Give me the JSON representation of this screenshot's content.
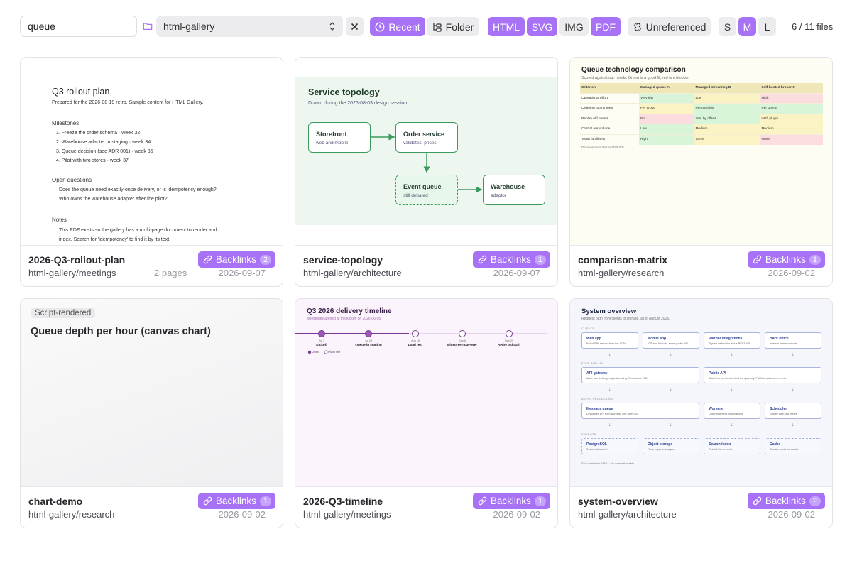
{
  "toolbar": {
    "search_value": "queue",
    "folder_select": "html-gallery",
    "buttons": {
      "recent": "Recent",
      "folder": "Folder",
      "html": "HTML",
      "svg": "SVG",
      "img": "IMG",
      "pdf": "PDF",
      "unreferenced": "Unreferenced",
      "size_s": "S",
      "size_m": "M",
      "size_l": "L"
    },
    "file_count": "6 / 11 files",
    "colors": {
      "accent": "#a772f5",
      "neutral": "#ececef"
    }
  },
  "cards": [
    {
      "name": "2026-Q3-rollout-plan",
      "path": "html-gallery/meetings",
      "pages": "2 pages",
      "date": "2026-09-07",
      "backlinks_label": "Backlinks",
      "backlinks_count": "2",
      "preview": {
        "title": "Q3 rollout plan",
        "subtitle": "Prepared for the 2026-08-19 retro. Sample content for HTML Gallery.",
        "milestones_heading": "Milestones",
        "milestones": [
          "1.  Freeze the order schema  ·  week 32",
          "2.  Warehouse adapter in staging  ·  week 34",
          "3.  Queue decision (see ADR 001)  ·  week 35",
          "4.  Pilot with two stores  ·  week 37"
        ],
        "questions_heading": "Open questions",
        "questions": [
          "Does the queue need exactly-once delivery, or is idempotency enough?",
          "Who owns the warehouse adapter after the pilot?"
        ],
        "notes_heading": "Notes",
        "notes": [
          "This PDF exists so the gallery has a multi-page document to render and",
          "index. Search for 'idempotency' to find it by its text."
        ]
      }
    },
    {
      "name": "service-topology",
      "path": "html-gallery/architecture",
      "date": "2026-09-07",
      "backlinks_label": "Backlinks",
      "backlinks_count": "1",
      "preview": {
        "title": "Service topology",
        "subtitle": "Drawn during the 2026-08-03 design session",
        "nodes": [
          {
            "title": "Storefront",
            "sub": "web and mobile"
          },
          {
            "title": "Order service",
            "sub": "validates, prices"
          },
          {
            "title": "Event queue",
            "sub": "still debated"
          },
          {
            "title": "Warehouse",
            "sub": "adaptor"
          }
        ]
      }
    },
    {
      "name": "comparison-matrix",
      "path": "html-gallery/research",
      "date": "2026-09-02",
      "backlinks_label": "Backlinks",
      "backlinks_count": "1",
      "preview": {
        "title": "Queue technology comparison",
        "subtitle": "Scored against our needs. Green is a good fit, red is a blocker.",
        "headers": [
          "Criterion",
          "Managed queue A",
          "Managed streaming B",
          "Self-hosted broker C"
        ],
        "rows": [
          [
            "Operational effort",
            "Very low",
            "Low",
            "High"
          ],
          [
            "Ordering guarantees",
            "Per group",
            "Per partition",
            "Per queue"
          ],
          [
            "Replay old events",
            "No",
            "Yes, by offset",
            "With plugin"
          ],
          [
            "Cost at our volume",
            "Low",
            "Medium",
            "Medium"
          ],
          [
            "Team familiarity",
            "High",
            "Some",
            "None"
          ]
        ],
        "note": "Decision recorded in ADR 001."
      }
    },
    {
      "name": "chart-demo",
      "path": "html-gallery/research",
      "date": "2026-09-02",
      "backlinks_label": "Backlinks",
      "backlinks_count": "1",
      "preview": {
        "tag": "Script-rendered",
        "title": "Queue depth per hour (canvas chart)"
      }
    },
    {
      "name": "2026-Q3-timeline",
      "path": "html-gallery/meetings",
      "date": "2026-09-02",
      "backlinks_label": "Backlinks",
      "backlinks_count": "1",
      "preview": {
        "title": "Q3 2026 delivery timeline",
        "subtitle": "Milestones agreed at the kickoff on 2026-06-05.",
        "milestones": [
          {
            "date": "Jul 7",
            "label": "Kickoff",
            "done": true
          },
          {
            "date": "Jul 28",
            "label": "Queue in staging",
            "done": true
          },
          {
            "date": "Aug 18",
            "label": "Load test",
            "done": false
          },
          {
            "date": "Sep 8",
            "label": "Bluegreen cut-over",
            "done": false
          },
          {
            "date": "Sep 29",
            "label": "Retire old path",
            "done": false
          }
        ],
        "legend_done": "Done",
        "legend_planned": "Planned"
      }
    },
    {
      "name": "system-overview",
      "path": "html-gallery/architecture",
      "date": "2026-09-02",
      "backlinks_label": "Backlinks",
      "backlinks_count": "2",
      "preview": {
        "title": "System overview",
        "subtitle": "Request path from clients to storage, as of August 2026.",
        "groups": [
          "CLIENTS",
          "EDGE AND API",
          "ASYNC PROCESSING",
          "STORAGE"
        ],
        "clients": [
          {
            "t": "Web app",
            "s": "React SPA served from the CDN."
          },
          {
            "t": "Mobile app",
            "s": "iOS and Android, same public API."
          },
          {
            "t": "Partner integrations",
            "s": "Signed webhooks and a REST API."
          },
          {
            "t": "Back office",
            "s": "Internal admin console."
          }
        ],
        "edge": [
          {
            "t": "API gateway",
            "s": "Auth, rate limiting, request routing. Terminates TLS."
          },
          {
            "t": "Public API",
            "s": "Stateless services behind the gateway. Publishes domain events."
          }
        ],
        "async": [
          {
            "t": "Message queue",
            "s": "Decouples API from workers. See ADR 001."
          },
          {
            "t": "Workers",
            "s": "Order fulfilment, notifications."
          },
          {
            "t": "Scheduler",
            "s": "Nightly jobs and retries."
          }
        ],
        "storage": [
          {
            "t": "PostgreSQL",
            "s": "System of record."
          },
          {
            "t": "Object storage",
            "s": "Files, exports, images."
          },
          {
            "t": "Search index",
            "s": "Rebuilt from events."
          },
          {
            "t": "Cache",
            "s": "Sessions and hot reads."
          }
        ],
        "footer": "Self-contained HTML · No external assets"
      }
    }
  ]
}
